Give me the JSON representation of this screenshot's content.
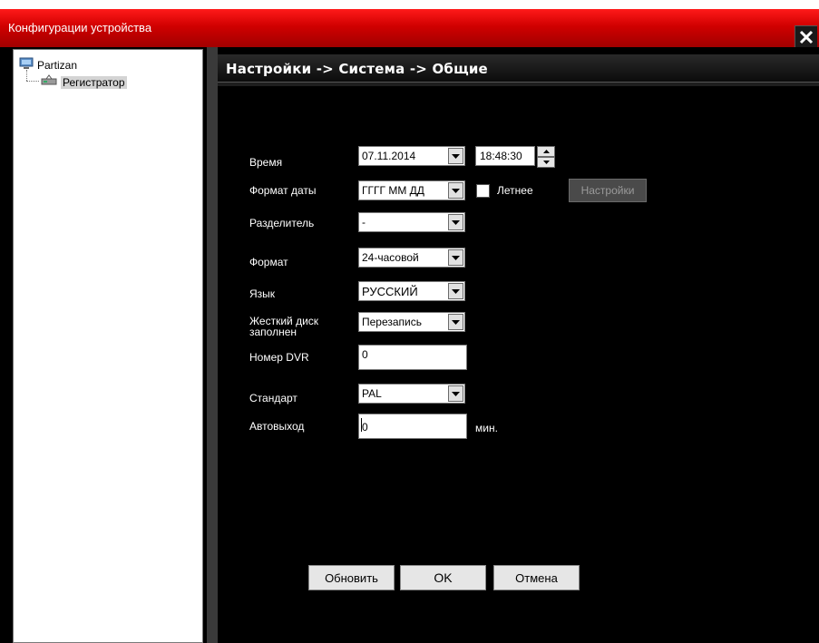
{
  "window": {
    "title": "Конфигурации устройства",
    "close_icon": "close-icon"
  },
  "tree": {
    "root": {
      "label": "Partizan",
      "icon": "network-icon"
    },
    "child": {
      "label": "Регистратор",
      "icon": "dvr-device-icon",
      "selected": true
    }
  },
  "main": {
    "breadcrumb": "Настройки -> Система -> Общие",
    "fields": {
      "time": {
        "label": "Время",
        "date_value": "07.11.2014",
        "time_value": "18:48:30"
      },
      "date_format": {
        "label": "Формат даты",
        "value": "ГГГГ ММ ДД",
        "dst_label": "Летнее",
        "dst_checked": false,
        "settings_button": "Настройки"
      },
      "separator": {
        "label": "Разделитель",
        "value": "-"
      },
      "format": {
        "label": "Формат",
        "value": "24-часовой"
      },
      "language": {
        "label": "Язык",
        "value": "РУССКИЙ"
      },
      "hdd_full": {
        "label_line1": "Жесткий диск",
        "label_line2": "заполнен",
        "value": "Перезапись"
      },
      "dvr_number": {
        "label": "Номер DVR",
        "value": "0"
      },
      "standard": {
        "label": "Стандарт",
        "value": "PAL"
      },
      "autologout": {
        "label": "Автовыход",
        "value": "0",
        "unit": "мин."
      }
    },
    "buttons": {
      "refresh": "Обновить",
      "ok": "OK",
      "cancel": "Отмена"
    }
  }
}
